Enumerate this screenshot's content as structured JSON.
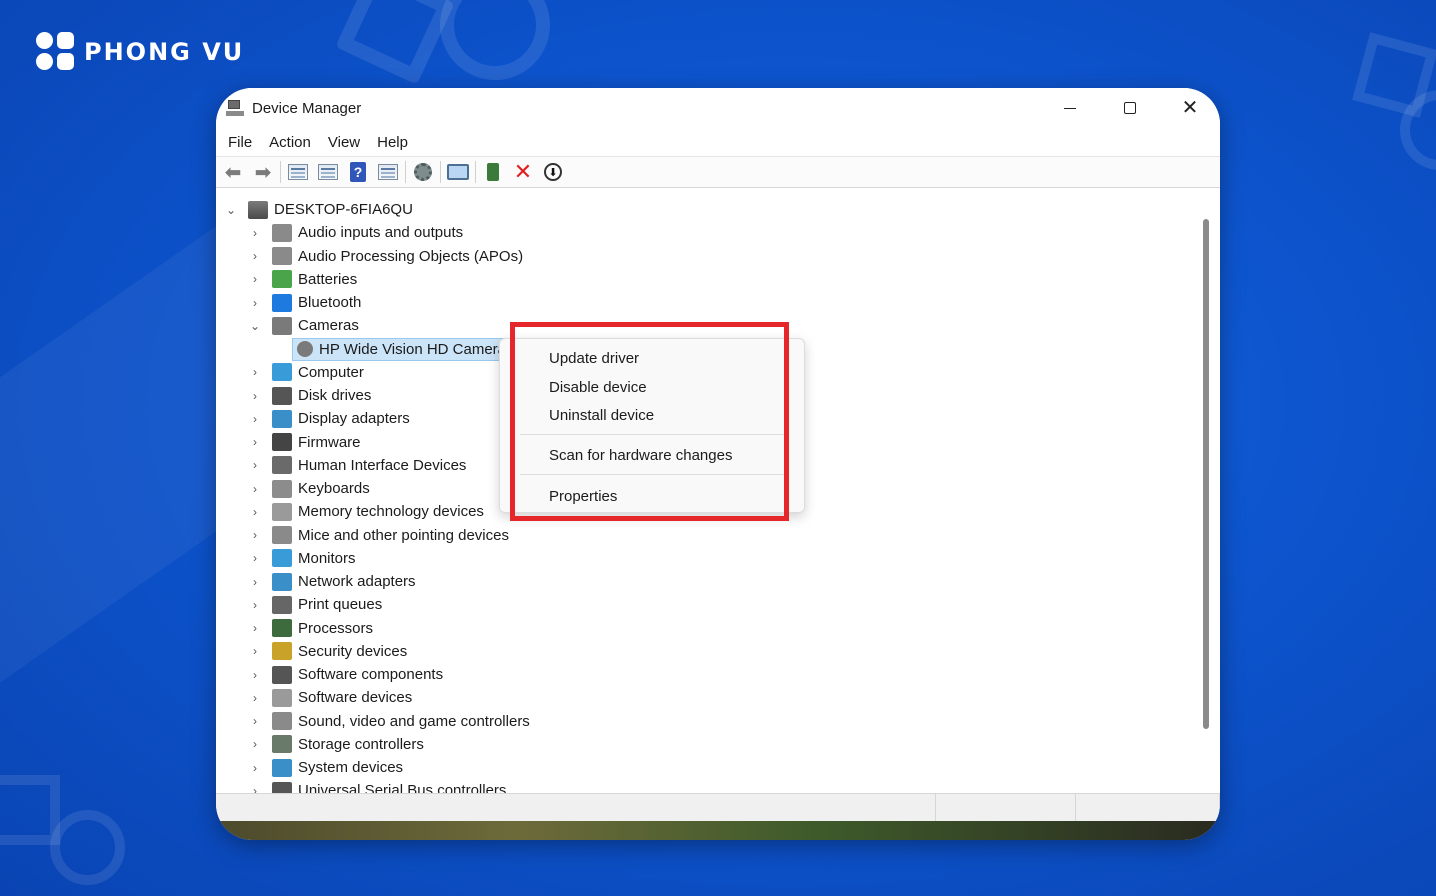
{
  "brand": {
    "name": "PHONG VU"
  },
  "window": {
    "title": "Device Manager",
    "controls": {
      "minimize": "—",
      "maximize": "☐",
      "close": "✕"
    }
  },
  "menubar": {
    "items": [
      "File",
      "Action",
      "View",
      "Help"
    ]
  },
  "tree": {
    "root": "DESKTOP-6FIA6QU",
    "items": [
      {
        "label": "Audio inputs and outputs",
        "expanded": false,
        "icon": "speaker-icon",
        "color": "#8a8a8a"
      },
      {
        "label": "Audio Processing Objects (APOs)",
        "expanded": false,
        "icon": "speaker-icon",
        "color": "#8a8a8a"
      },
      {
        "label": "Batteries",
        "expanded": false,
        "icon": "battery-icon",
        "color": "#4aa54a"
      },
      {
        "label": "Bluetooth",
        "expanded": false,
        "icon": "bluetooth-icon",
        "color": "#1f7ae0"
      },
      {
        "label": "Cameras",
        "expanded": true,
        "icon": "camera-icon",
        "color": "#7a7a7a"
      },
      {
        "label": "Computer",
        "expanded": false,
        "icon": "computer-icon",
        "color": "#3a9bd9"
      },
      {
        "label": "Disk drives",
        "expanded": false,
        "icon": "disk-icon",
        "color": "#555555"
      },
      {
        "label": "Display adapters",
        "expanded": false,
        "icon": "display-adapter-icon",
        "color": "#3a8fc9"
      },
      {
        "label": "Firmware",
        "expanded": false,
        "icon": "firmware-icon",
        "color": "#444444"
      },
      {
        "label": "Human Interface Devices",
        "expanded": false,
        "icon": "hid-icon",
        "color": "#6a6a6a"
      },
      {
        "label": "Keyboards",
        "expanded": false,
        "icon": "keyboard-icon",
        "color": "#8c8c8c"
      },
      {
        "label": "Memory technology devices",
        "expanded": false,
        "icon": "memory-icon",
        "color": "#9a9a9a"
      },
      {
        "label": "Mice and other pointing devices",
        "expanded": false,
        "icon": "mouse-icon",
        "color": "#8a8a8a"
      },
      {
        "label": "Monitors",
        "expanded": false,
        "icon": "monitor-icon",
        "color": "#3a9bd9"
      },
      {
        "label": "Network adapters",
        "expanded": false,
        "icon": "network-icon",
        "color": "#3a8fc9"
      },
      {
        "label": "Print queues",
        "expanded": false,
        "icon": "printer-icon",
        "color": "#666666"
      },
      {
        "label": "Processors",
        "expanded": false,
        "icon": "processor-icon",
        "color": "#3e6b3e"
      },
      {
        "label": "Security devices",
        "expanded": false,
        "icon": "security-icon",
        "color": "#c9a22a"
      },
      {
        "label": "Software components",
        "expanded": false,
        "icon": "software-component-icon",
        "color": "#555555"
      },
      {
        "label": "Software devices",
        "expanded": false,
        "icon": "software-device-icon",
        "color": "#9a9a9a"
      },
      {
        "label": "Sound, video and game controllers",
        "expanded": false,
        "icon": "sound-icon",
        "color": "#8a8a8a"
      },
      {
        "label": "Storage controllers",
        "expanded": false,
        "icon": "storage-icon",
        "color": "#6a7a6a"
      },
      {
        "label": "System devices",
        "expanded": false,
        "icon": "system-device-icon",
        "color": "#3a8fc9"
      },
      {
        "label": "Universal Serial Bus controllers",
        "expanded": false,
        "icon": "usb-icon",
        "color": "#555555"
      }
    ],
    "camera_child": "HP Wide Vision HD Camera"
  },
  "context_menu": {
    "items": [
      "Update driver",
      "Disable device",
      "Uninstall device",
      "Scan for hardware changes",
      "Properties"
    ],
    "highlight_color": "#e5262b"
  }
}
